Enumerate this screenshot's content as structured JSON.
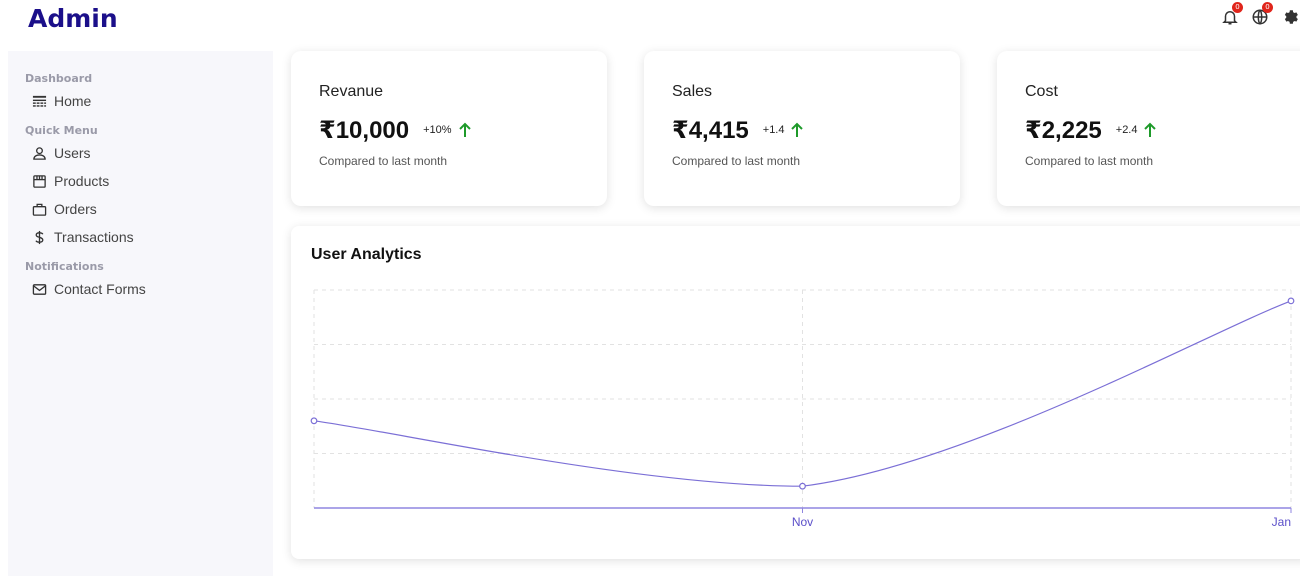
{
  "header": {
    "logo": "Admin",
    "notifications": {
      "icon": "bell-icon",
      "count": "0"
    },
    "language": {
      "icon": "globe-icon",
      "count": "0"
    },
    "settings": {
      "icon": "gear-icon"
    }
  },
  "sidebar": {
    "sections": [
      {
        "title": "Dashboard",
        "items": [
          {
            "label": "Home",
            "icon": "home-icon"
          }
        ]
      },
      {
        "title": "Quick Menu",
        "items": [
          {
            "label": "Users",
            "icon": "user-icon"
          },
          {
            "label": "Products",
            "icon": "store-icon"
          },
          {
            "label": "Orders",
            "icon": "briefcase-icon"
          },
          {
            "label": "Transactions",
            "icon": "dollar-icon"
          }
        ]
      },
      {
        "title": "Notifications",
        "items": [
          {
            "label": "Contact Forms",
            "icon": "mail-icon"
          }
        ]
      }
    ]
  },
  "cards": [
    {
      "title": "Revanue",
      "value": "₹10,000",
      "change": "+10%",
      "subtitle": "Compared to last month"
    },
    {
      "title": "Sales",
      "value": "₹4,415",
      "change": "+1.4",
      "subtitle": "Compared to last month"
    },
    {
      "title": "Cost",
      "value": "₹2,225",
      "change": "+2.4",
      "subtitle": "Compared to last month"
    }
  ],
  "colors": {
    "brand": "#1b0f8a",
    "line": "#7b6fd6",
    "up_arrow": "#1e9a2a",
    "badge": "#e0251b"
  },
  "chart_data": {
    "type": "line",
    "title": "User Analytics",
    "x": [
      "",
      "Nov",
      "Jan"
    ],
    "series": [
      {
        "values": [
          1600,
          400,
          3800
        ]
      }
    ],
    "ylim": [
      0,
      4000
    ],
    "grid": true,
    "legend": "none"
  }
}
